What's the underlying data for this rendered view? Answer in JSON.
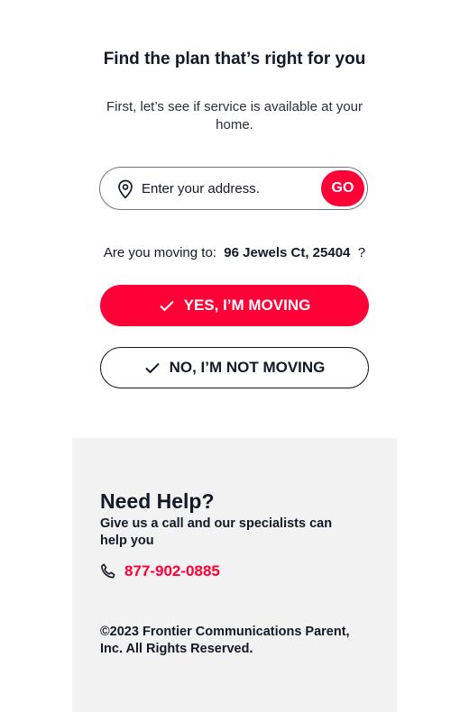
{
  "hero": {
    "title": "Find the plan that’s right for you",
    "subtitle": "First, let’s see if service is available at your home."
  },
  "address_search": {
    "placeholder": "Enter your address.",
    "value": "",
    "go_label": "GO",
    "icon": "location-pin-icon"
  },
  "moving": {
    "question_prefix": "Are you moving to:",
    "address": "96 Jewels Ct, 25404",
    "question_suffix": "?",
    "yes_label": "YES, I’M MOVING",
    "no_label": "NO, I’M NOT MOVING"
  },
  "help": {
    "title": "Need Help?",
    "text": "Give us a call and our specialists can help you",
    "phone": "877-902-0885",
    "phone_icon": "phone-icon",
    "copyright": "©2023 Frontier Communications Parent, Inc. All Rights Reserved."
  },
  "colors": {
    "brand_red": "#ff0037",
    "text_dark": "#141928",
    "panel_bg": "#f2f2f2"
  }
}
